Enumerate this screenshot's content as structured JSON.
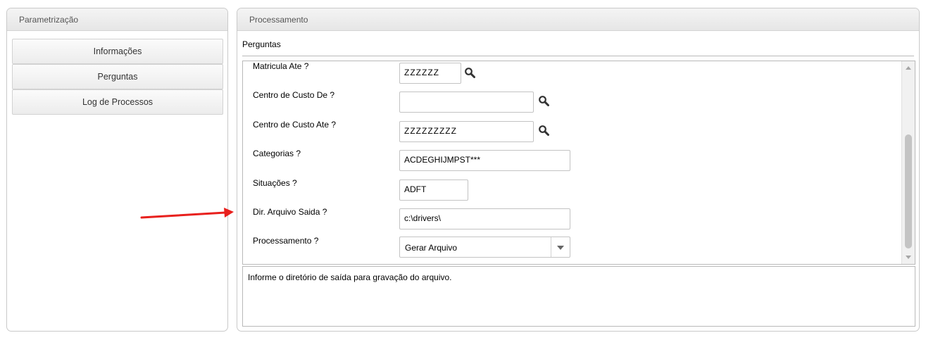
{
  "left_panel": {
    "title": "Parametrização",
    "items": [
      {
        "label": "Informações"
      },
      {
        "label": "Perguntas"
      },
      {
        "label": "Log de Processos"
      }
    ]
  },
  "right_panel": {
    "title": "Processamento",
    "subtitle": "Perguntas",
    "questions": [
      {
        "label": "Matricula Ate ?",
        "value": "ZZZZZZ"
      },
      {
        "label": "Centro de Custo De ?",
        "value": ""
      },
      {
        "label": "Centro de Custo Ate ?",
        "value": "ZZZZZZZZZ"
      },
      {
        "label": "Categorias ?",
        "value": "ACDEGHIJMPST***"
      },
      {
        "label": "Situações ?",
        "value": "ADFT"
      },
      {
        "label": "Dir. Arquivo Saida ?",
        "value": "c:\\drivers\\"
      },
      {
        "label": "Processamento ?",
        "value": "Gerar Arquivo"
      }
    ],
    "help_text": "Informe o diretório de saída para gravação do arquivo."
  },
  "colors": {
    "annotation_arrow": "#e8201d"
  }
}
